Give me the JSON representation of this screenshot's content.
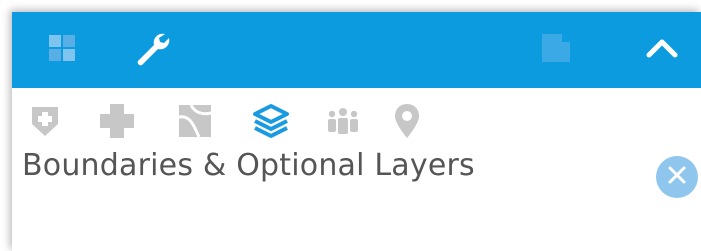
{
  "panel": {
    "section_title": "Boundaries & Optional Layers"
  },
  "topbar": {
    "background": "#0d9be0",
    "left_buttons": [
      {
        "icon": "grid-icon"
      },
      {
        "icon": "wrench-icon",
        "active": true
      }
    ],
    "right_buttons": [
      {
        "icon": "window-icon"
      },
      {
        "icon": "collapse-chevron-up-icon"
      }
    ]
  },
  "toolbar": {
    "tools": [
      {
        "icon": "shield-plus-icon",
        "active": false
      },
      {
        "icon": "medical-cross-icon",
        "active": false
      },
      {
        "icon": "map-icon",
        "active": false
      },
      {
        "icon": "layers-icon",
        "active": true
      },
      {
        "icon": "people-group-icon",
        "active": false
      },
      {
        "icon": "map-pin-icon",
        "active": false
      }
    ],
    "inactive_color": "#c7c7c7",
    "active_color": "#1a9ae0"
  },
  "close": {
    "icon": "close-x-icon",
    "color": "#8fc6ee"
  }
}
